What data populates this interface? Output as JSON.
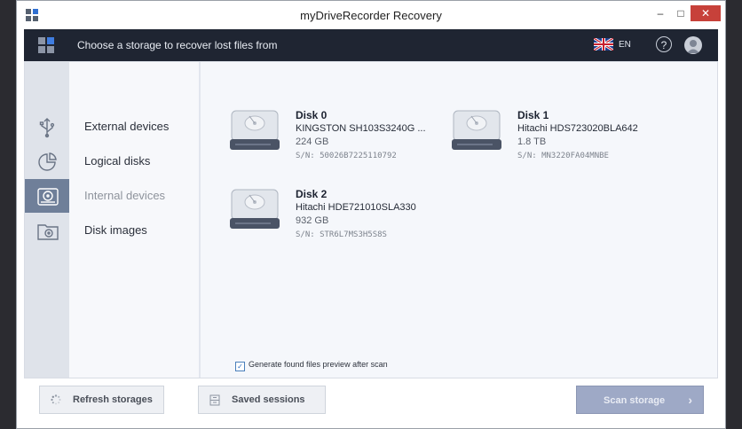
{
  "window": {
    "title": "myDriveRecorder Recovery",
    "minimize": "–",
    "maximize": "□",
    "close": "✕"
  },
  "header": {
    "prompt": "Choose a storage to recover lost files from",
    "language": "EN",
    "help": "?"
  },
  "nav": {
    "items": [
      {
        "label": "External devices",
        "icon": "usb-icon",
        "active": false
      },
      {
        "label": "Logical disks",
        "icon": "pie-chart-icon",
        "active": false
      },
      {
        "label": "Internal devices",
        "icon": "hard-drive-icon",
        "active": true
      },
      {
        "label": "Disk images",
        "icon": "disk-image-icon",
        "active": false
      }
    ]
  },
  "disks": [
    {
      "name": "Disk 0",
      "model": "KINGSTON SH103S3240G   ...",
      "size": "224 GB",
      "serial": "S/N: 50026B7225110792"
    },
    {
      "name": "Disk 1",
      "model": "Hitachi HDS723020BLA642",
      "size": "1.8 TB",
      "serial": "S/N: MN3220FA04MNBE"
    },
    {
      "name": "Disk 2",
      "model": "Hitachi HDE721010SLA330",
      "size": "932 GB",
      "serial": "S/N: STR6L7MS3H5S8S"
    }
  ],
  "options": {
    "preview_label": "Generate found files preview after scan",
    "preview_checked": true
  },
  "footer": {
    "refresh_label": "Refresh storages",
    "sessions_label": "Saved sessions",
    "scan_label": "Scan storage",
    "scan_chevron": "›"
  }
}
